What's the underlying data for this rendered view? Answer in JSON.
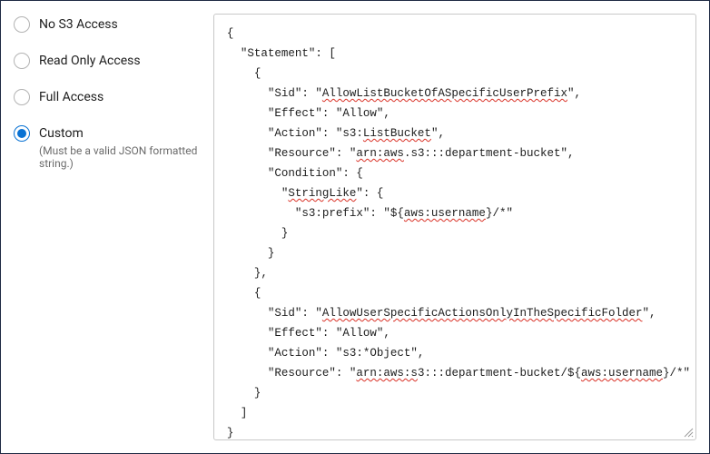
{
  "options": {
    "no_access": {
      "label": "No S3 Access",
      "selected": false
    },
    "read_only": {
      "label": "Read Only Access",
      "selected": false
    },
    "full": {
      "label": "Full Access",
      "selected": false
    },
    "custom": {
      "label": "Custom",
      "selected": true,
      "hint": "(Must be a valid JSON formatted string.)"
    }
  },
  "policy_json": {
    "Statement": [
      {
        "Sid": "AllowListBucketOfASpecificUserPrefix",
        "Effect": "Allow",
        "Action": "s3:ListBucket",
        "Resource": "arn:aws.s3:::department-bucket",
        "Condition": {
          "StringLike": {
            "s3:prefix": "${aws:username}/*"
          }
        }
      },
      {
        "Sid": "AllowUserSpecificActionsOnlyInTheSpecificFolder",
        "Effect": "Allow",
        "Action": "s3:*Object",
        "Resource": "arn:aws:s3:::department-bucket/${aws:username}/*"
      }
    ]
  },
  "code_lines": [
    {
      "indent": 0,
      "segments": [
        {
          "t": "{"
        }
      ]
    },
    {
      "indent": 1,
      "segments": [
        {
          "t": "\"Statement\": ["
        }
      ]
    },
    {
      "indent": 2,
      "segments": [
        {
          "t": "{"
        }
      ]
    },
    {
      "indent": 3,
      "segments": [
        {
          "t": "\"Sid\": \""
        },
        {
          "t": "AllowListBucketOfASpecificUserPrefix",
          "sp": true
        },
        {
          "t": "\","
        }
      ]
    },
    {
      "indent": 3,
      "segments": [
        {
          "t": "\"Effect\": \"Allow\","
        }
      ]
    },
    {
      "indent": 3,
      "segments": [
        {
          "t": "\"Action\": \"s3:"
        },
        {
          "t": "ListBucket",
          "sp": true
        },
        {
          "t": "\","
        }
      ]
    },
    {
      "indent": 3,
      "segments": [
        {
          "t": "\"Resource\": \""
        },
        {
          "t": "arn:aws",
          "sp": true
        },
        {
          "t": ".s3:::department-bucket\","
        }
      ]
    },
    {
      "indent": 3,
      "segments": [
        {
          "t": "\"Condition\": {"
        }
      ]
    },
    {
      "indent": 4,
      "segments": [
        {
          "t": "\""
        },
        {
          "t": "StringLike",
          "sp": true
        },
        {
          "t": "\": {"
        }
      ]
    },
    {
      "indent": 5,
      "segments": [
        {
          "t": "\"s3:prefix\": \"${"
        },
        {
          "t": "aws:username",
          "sp": true
        },
        {
          "t": "}/*\""
        }
      ]
    },
    {
      "indent": 4,
      "segments": [
        {
          "t": "}"
        }
      ]
    },
    {
      "indent": 3,
      "segments": [
        {
          "t": "}"
        }
      ]
    },
    {
      "indent": 2,
      "segments": [
        {
          "t": "},"
        }
      ]
    },
    {
      "indent": 2,
      "segments": [
        {
          "t": "{"
        }
      ]
    },
    {
      "indent": 3,
      "segments": [
        {
          "t": "\"Sid\": \""
        },
        {
          "t": "AllowUserSpecificActionsOnlyInTheSpecificFolder",
          "sp": true
        },
        {
          "t": "\","
        }
      ]
    },
    {
      "indent": 3,
      "segments": [
        {
          "t": "\"Effect\": \"Allow\","
        }
      ]
    },
    {
      "indent": 3,
      "segments": [
        {
          "t": "\"Action\": \"s3:*Object\","
        }
      ]
    },
    {
      "indent": 3,
      "segments": [
        {
          "t": "\"Resource\": \""
        },
        {
          "t": "arn:aws:s",
          "sp": true
        },
        {
          "t": "3:::department-bucket/${"
        },
        {
          "t": "aws:username",
          "sp": true
        },
        {
          "t": "}/*\""
        }
      ]
    },
    {
      "indent": 2,
      "segments": [
        {
          "t": "}"
        }
      ]
    },
    {
      "indent": 1,
      "segments": [
        {
          "t": "]"
        }
      ]
    },
    {
      "indent": 0,
      "segments": [
        {
          "t": "}"
        }
      ]
    }
  ]
}
